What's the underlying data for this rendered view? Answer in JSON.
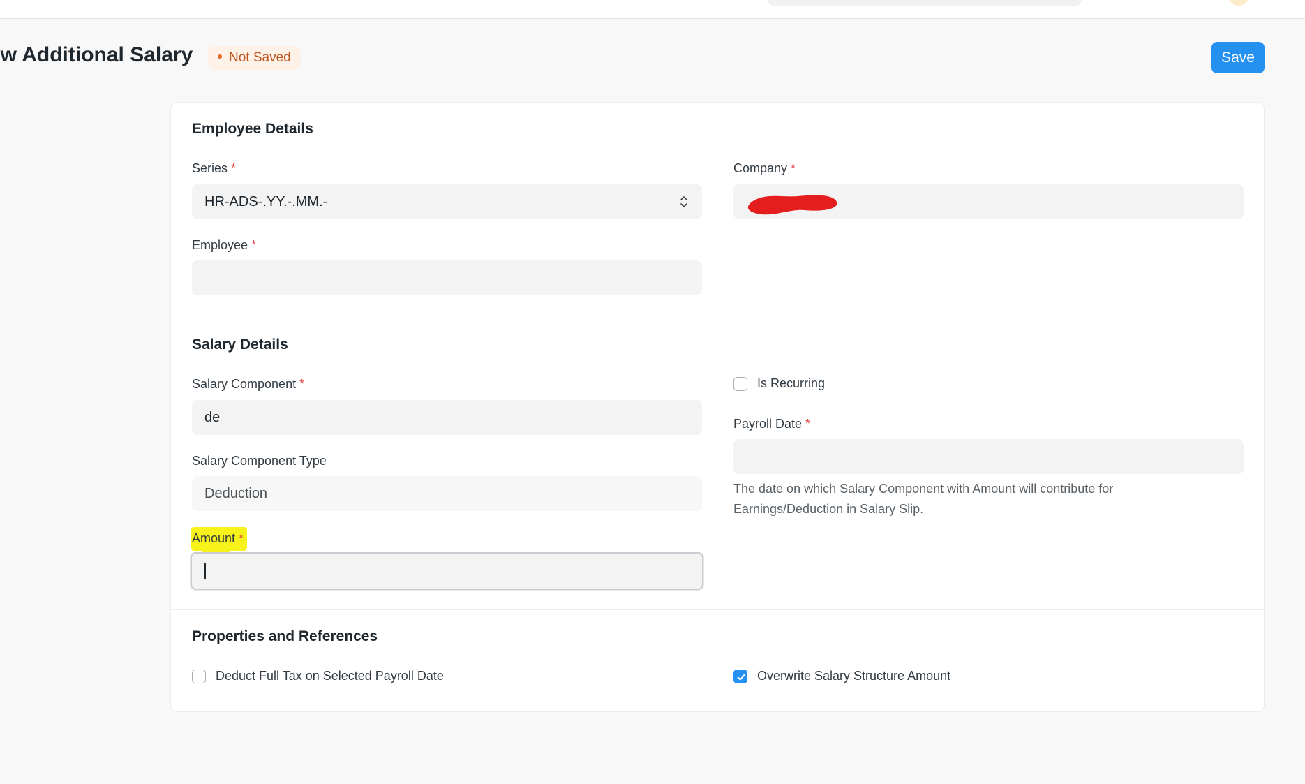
{
  "page": {
    "title": "ew Additional Salary",
    "status": "Not Saved",
    "save_label": "Save"
  },
  "sections": {
    "employee_details": {
      "title": "Employee Details",
      "series": {
        "label": "Series",
        "value": "HR-ADS-.YY.-.MM.-"
      },
      "company": {
        "label": "Company",
        "value": ""
      },
      "employee": {
        "label": "Employee",
        "value": ""
      }
    },
    "salary_details": {
      "title": "Salary Details",
      "salary_component": {
        "label": "Salary Component",
        "value": "de"
      },
      "salary_component_type": {
        "label": "Salary Component Type",
        "value": "Deduction"
      },
      "amount": {
        "label": "Amount",
        "value": ""
      },
      "is_recurring": {
        "label": "Is Recurring",
        "checked": false
      },
      "payroll_date": {
        "label": "Payroll Date",
        "value": "",
        "help_line1": "The date on which Salary Component with Amount will contribute for",
        "help_line2": "Earnings/Deduction in Salary Slip."
      }
    },
    "properties": {
      "title": "Properties and References",
      "deduct_full_tax": {
        "label": "Deduct Full Tax on Selected Payroll Date",
        "checked": false
      },
      "overwrite_salary_structure": {
        "label": "Overwrite Salary Structure Amount",
        "checked": true
      }
    }
  },
  "required_marker": "*",
  "colors": {
    "primary": "#2490ef",
    "required": "#e24c4c",
    "status_text": "#c0521a",
    "highlight": "#f6f21a",
    "redaction": "#e41e1e"
  }
}
